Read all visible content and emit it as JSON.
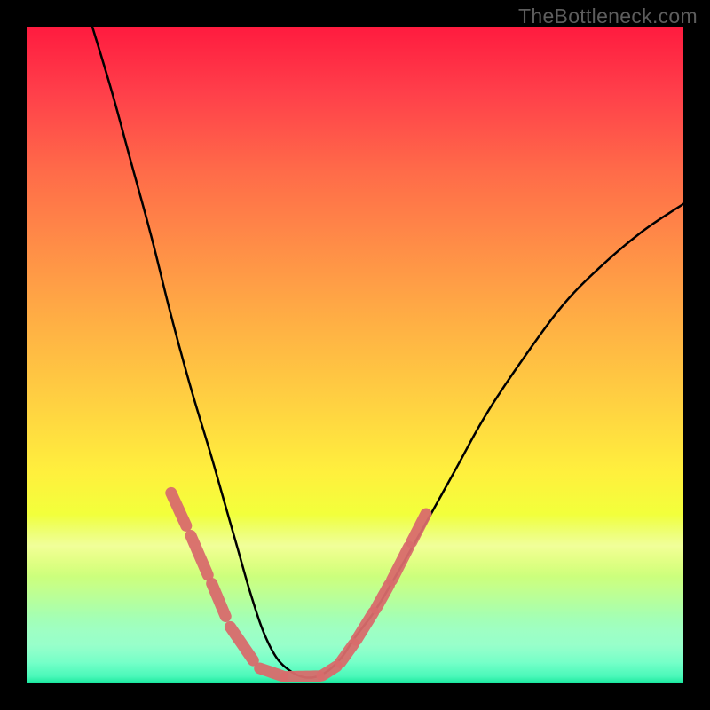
{
  "watermark": "TheBottleneck.com",
  "colors": {
    "curve": "#000000",
    "dots": "#d86c6c",
    "background_black": "#000000"
  },
  "chart_data": {
    "type": "line",
    "title": "",
    "xlabel": "",
    "ylabel": "",
    "xlim": [
      0,
      100
    ],
    "ylim": [
      0,
      100
    ],
    "grid": false,
    "legend": false,
    "comment": "V-shaped bottleneck curve. x is normalized horizontal position (0=left, 100=right); y is normalized vertical position (0=bottom green, 100=top red). Minimum near x≈36–42, y≈1.",
    "series": [
      {
        "name": "bottleneck_curve",
        "x": [
          10,
          13,
          16,
          19,
          22,
          25,
          28,
          30,
          32,
          34,
          36,
          38,
          40,
          42,
          44,
          46,
          48,
          50,
          53,
          56,
          60,
          65,
          70,
          76,
          82,
          88,
          94,
          100
        ],
        "y": [
          100,
          90,
          79,
          68,
          56,
          45,
          35,
          28,
          21,
          14,
          8,
          4,
          2,
          1,
          1,
          2,
          4,
          7,
          11,
          16,
          23,
          32,
          41,
          50,
          58,
          64,
          69,
          73
        ]
      }
    ],
    "dot_overlays": {
      "comment": "Pink dashed overlay segments along the curve near the bottom.",
      "segments": [
        {
          "x": [
            22,
            24.3
          ],
          "y": [
            29,
            24
          ]
        },
        {
          "x": [
            25,
            27.6
          ],
          "y": [
            22.5,
            16.5
          ]
        },
        {
          "x": [
            28.2,
            30.3
          ],
          "y": [
            15.2,
            10.2
          ]
        },
        {
          "x": [
            31,
            34.5
          ],
          "y": [
            8.6,
            3.5
          ]
        },
        {
          "x": [
            35.5,
            39
          ],
          "y": [
            2.3,
            1.1
          ]
        },
        {
          "x": [
            39.5,
            44.5
          ],
          "y": [
            1,
            1.1
          ]
        },
        {
          "x": [
            45,
            47.2
          ],
          "y": [
            1.2,
            2.6
          ]
        },
        {
          "x": [
            47.8,
            49.8
          ],
          "y": [
            3.2,
            6
          ]
        },
        {
          "x": [
            50.2,
            52.8
          ],
          "y": [
            6.6,
            10.8
          ]
        },
        {
          "x": [
            53.2,
            55.2
          ],
          "y": [
            11.4,
            15
          ]
        },
        {
          "x": [
            55.6,
            58.2
          ],
          "y": [
            15.7,
            20.8
          ]
        },
        {
          "x": [
            58.6,
            60.8
          ],
          "y": [
            21.5,
            25.8
          ]
        }
      ]
    }
  }
}
